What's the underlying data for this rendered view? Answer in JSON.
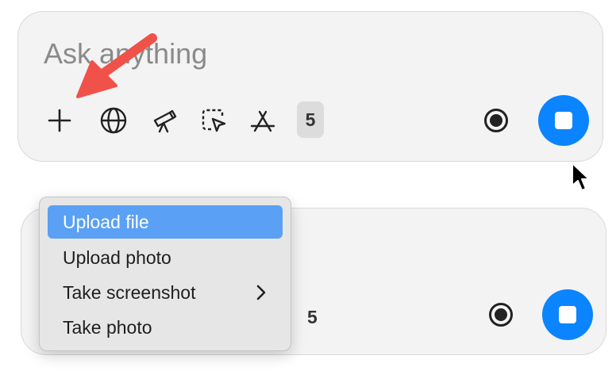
{
  "composer_top": {
    "placeholder": "Ask anything",
    "tool_count": "5"
  },
  "composer_bottom": {
    "tool_count": "5"
  },
  "attach_menu": {
    "items": [
      {
        "label": "Upload file",
        "selected": true
      },
      {
        "label": "Upload photo",
        "selected": false
      },
      {
        "label": "Take screenshot",
        "submenu": true
      },
      {
        "label": "Take photo",
        "selected": false
      }
    ]
  },
  "colors": {
    "accent": "#0a84ff",
    "menu_highlight": "#5aa0f5",
    "annotation_arrow": "#f0524a"
  },
  "icons": [
    "plus-icon",
    "globe-icon",
    "telescope-icon",
    "cursor-select-icon",
    "app-store-icon",
    "record-icon",
    "stop-icon",
    "chevron-right-icon",
    "mouse-pointer-icon"
  ]
}
